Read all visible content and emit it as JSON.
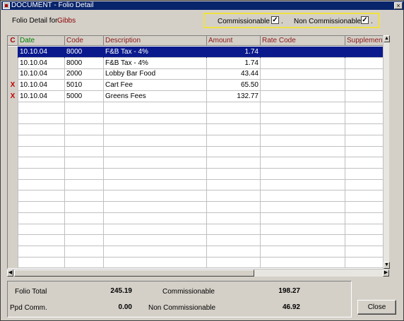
{
  "window": {
    "title": "DOCUMENT - Folio Detail",
    "close_glyph": "×"
  },
  "header": {
    "folio_label": "Folio Detail for",
    "guest_name": "Gibbs",
    "commissionable_label": "Commissionable",
    "commissionable_checked": true,
    "non_commissionable_label": "Non Commissionable",
    "non_commissionable_checked": true,
    "check_glyph": "✓",
    "dot": "."
  },
  "table": {
    "columns": [
      "C",
      "Date",
      "Code",
      "Description",
      "Amount",
      "Rate Code",
      "Supplement"
    ],
    "rows": [
      {
        "mark": "",
        "date": "10.10.04",
        "code": "8000",
        "description": "F&B Tax - 4%",
        "amount": "1.74",
        "rate_code": "",
        "supplement": "",
        "selected": true
      },
      {
        "mark": "",
        "date": "10.10.04",
        "code": "8000",
        "description": "F&B Tax - 4%",
        "amount": "1.74",
        "rate_code": "",
        "supplement": "",
        "selected": false
      },
      {
        "mark": "",
        "date": "10.10.04",
        "code": "2000",
        "description": "Lobby Bar Food",
        "amount": "43.44",
        "rate_code": "",
        "supplement": "",
        "selected": false
      },
      {
        "mark": "X",
        "date": "10.10.04",
        "code": "5010",
        "description": "Cart Fee",
        "amount": "65.50",
        "rate_code": "",
        "supplement": "",
        "selected": false
      },
      {
        "mark": "X",
        "date": "10.10.04",
        "code": "5000",
        "description": "Greens Fees",
        "amount": "132.77",
        "rate_code": "",
        "supplement": "",
        "selected": false
      }
    ]
  },
  "scroll": {
    "up": "▲",
    "down": "▼",
    "left": "◀",
    "right": "▶"
  },
  "totals": {
    "folio_total_label": "Folio Total",
    "folio_total_value": "245.19",
    "ppd_comm_label": "Ppd Comm.",
    "ppd_comm_value": "0.00",
    "commissionable_label": "Commissionable",
    "commissionable_value": "198.27",
    "non_commissionable_label": "Non Commissionable",
    "non_commissionable_value": "46.92"
  },
  "buttons": {
    "close_label": "Close"
  }
}
